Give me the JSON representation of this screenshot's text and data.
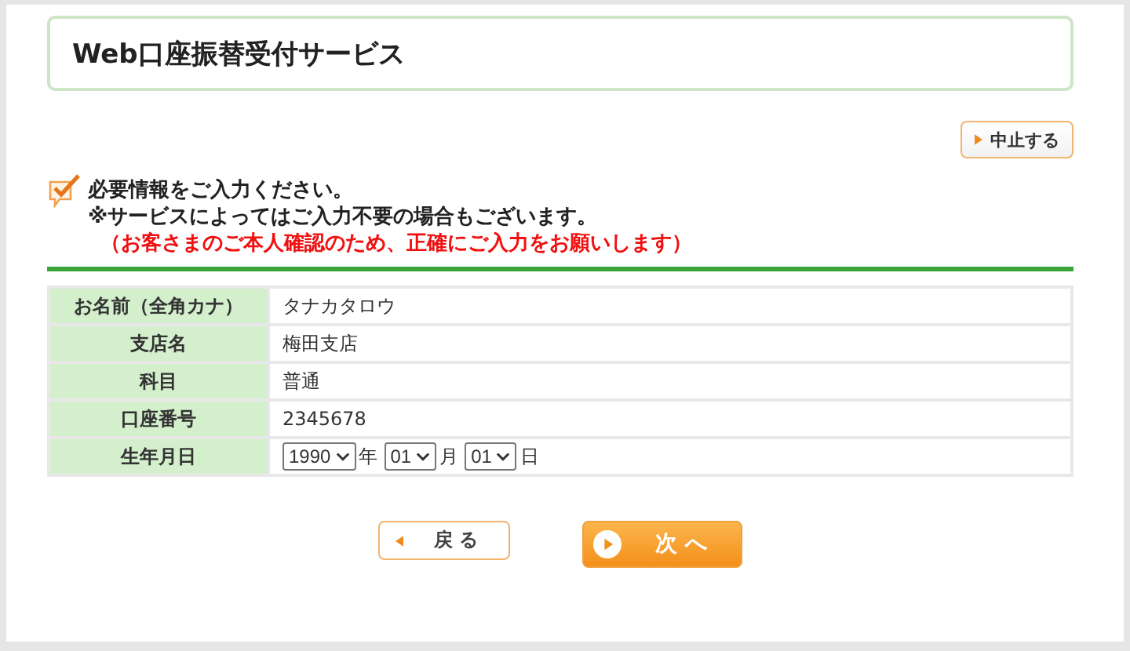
{
  "header": {
    "title": "Web口座振替受付サービス"
  },
  "cancel_button": {
    "label": "中止する"
  },
  "notice": {
    "lines": [
      {
        "text": "必要情報をご入力ください。",
        "kind": "normal"
      },
      {
        "text": "※サービスによってはご入力不要の場合もございます。",
        "kind": "normal"
      },
      {
        "text": "（お客さまのご本人確認のため、正確にご入力をお願いします）",
        "kind": "warning"
      }
    ]
  },
  "form": {
    "rows": [
      {
        "label": "お名前（全角カナ）",
        "kind": "text",
        "value": "タナカタロウ"
      },
      {
        "label": "支店名",
        "kind": "text",
        "value": "梅田支店"
      },
      {
        "label": "科目",
        "kind": "text",
        "value": "普通"
      },
      {
        "label": "口座番号",
        "kind": "text",
        "value": "2345678"
      },
      {
        "label": "生年月日",
        "kind": "date",
        "parts": [
          {
            "value": "1990",
            "suffix": "年"
          },
          {
            "value": "01",
            "suffix": "月"
          },
          {
            "value": "01",
            "suffix": "日"
          }
        ]
      }
    ]
  },
  "buttons": [
    {
      "label": "戻 る",
      "kind": "back"
    },
    {
      "label": "次 へ",
      "kind": "next"
    }
  ]
}
